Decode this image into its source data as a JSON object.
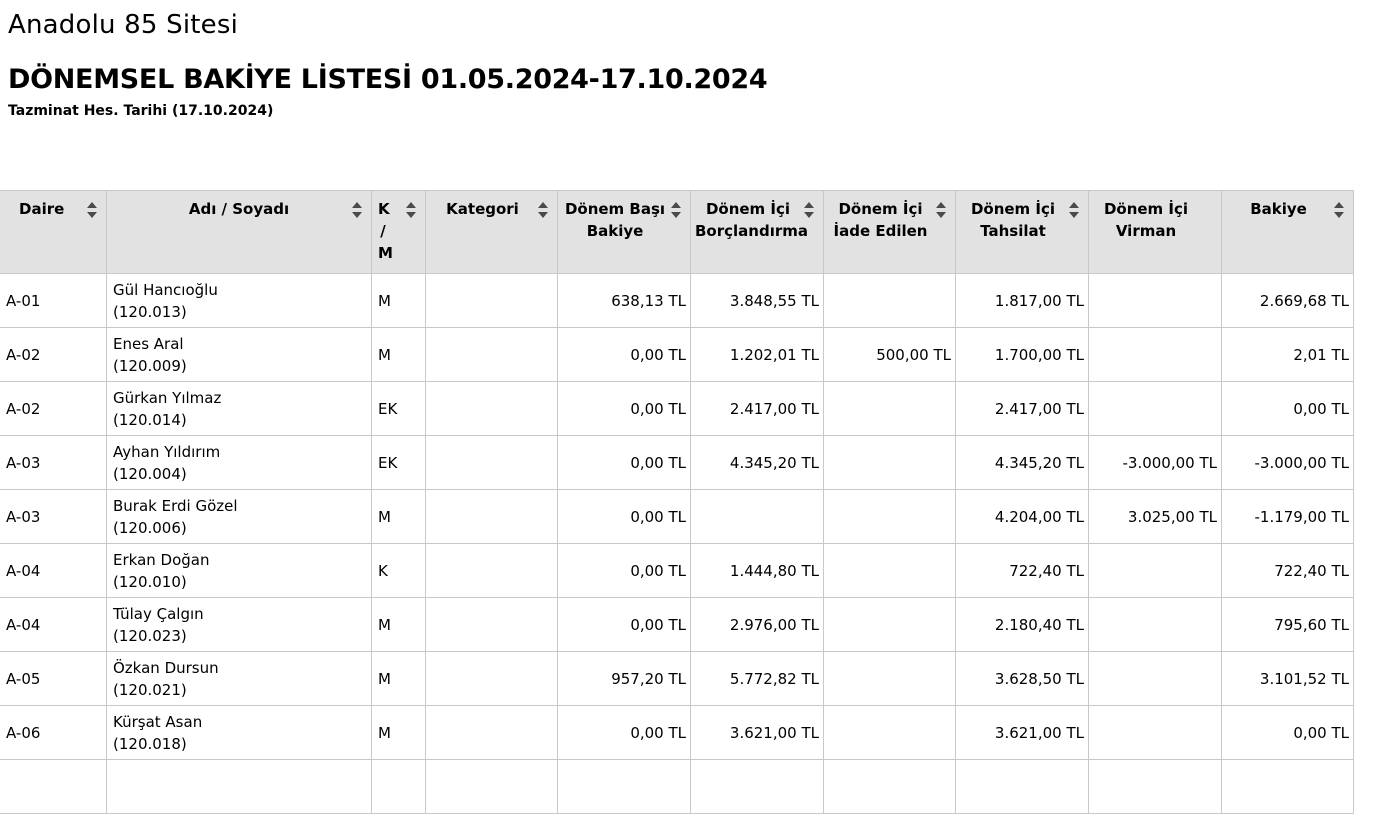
{
  "site": {
    "title": "Anadolu 85 Sitesi"
  },
  "report": {
    "title": "DÖNEMSEL BAKİYE LİSTESİ 01.05.2024-17.10.2024",
    "subtitle": "Tazminat Hes. Tarihi (17.10.2024)"
  },
  "table": {
    "headers": [
      {
        "label": "Daire",
        "sortable": true
      },
      {
        "label": "Adı / Soyadı",
        "sortable": true
      },
      {
        "label": "K / M",
        "sortable": true
      },
      {
        "label": "Kategori",
        "sortable": true
      },
      {
        "label": "Dönem Başı Bakiye",
        "sortable": true
      },
      {
        "label": "Dönem İçi Borçlandırma",
        "sortable": true
      },
      {
        "label": "Dönem İçi İade Edilen",
        "sortable": true
      },
      {
        "label": "Dönem İçi Tahsilat",
        "sortable": true
      },
      {
        "label": "Dönem İçi Virman",
        "sortable": false
      },
      {
        "label": "Bakiye",
        "sortable": true
      }
    ],
    "rows": [
      {
        "daire": "A-01",
        "name": "Gül Hancıoğlu",
        "code": "(120.013)",
        "km": "M",
        "kategori": "",
        "donem_basi": "638,13 TL",
        "borc": "3.848,55 TL",
        "iade": "",
        "tahsilat": "1.817,00 TL",
        "virman": "",
        "bakiye": "2.669,68 TL"
      },
      {
        "daire": "A-02",
        "name": "Enes Aral",
        "code": "(120.009)",
        "km": "M",
        "kategori": "",
        "donem_basi": "0,00 TL",
        "borc": "1.202,01 TL",
        "iade": "500,00 TL",
        "tahsilat": "1.700,00 TL",
        "virman": "",
        "bakiye": "2,01 TL"
      },
      {
        "daire": "A-02",
        "name": "Gürkan Yılmaz",
        "code": "(120.014)",
        "km": "EK",
        "kategori": "",
        "donem_basi": "0,00 TL",
        "borc": "2.417,00 TL",
        "iade": "",
        "tahsilat": "2.417,00 TL",
        "virman": "",
        "bakiye": "0,00 TL"
      },
      {
        "daire": "A-03",
        "name": "Ayhan Yıldırım",
        "code": "(120.004)",
        "km": "EK",
        "kategori": "",
        "donem_basi": "0,00 TL",
        "borc": "4.345,20 TL",
        "iade": "",
        "tahsilat": "4.345,20 TL",
        "virman": "-3.000,00 TL",
        "bakiye": "-3.000,00 TL"
      },
      {
        "daire": "A-03",
        "name": "Burak Erdi Gözel",
        "code": "(120.006)",
        "km": "M",
        "kategori": "",
        "donem_basi": "0,00 TL",
        "borc": "",
        "iade": "",
        "tahsilat": "4.204,00 TL",
        "virman": "3.025,00 TL",
        "bakiye": "-1.179,00 TL"
      },
      {
        "daire": "A-04",
        "name": "Erkan Doğan",
        "code": "(120.010)",
        "km": "K",
        "kategori": "",
        "donem_basi": "0,00 TL",
        "borc": "1.444,80 TL",
        "iade": "",
        "tahsilat": "722,40 TL",
        "virman": "",
        "bakiye": "722,40 TL"
      },
      {
        "daire": "A-04",
        "name": "Tülay Çalgın",
        "code": "(120.023)",
        "km": "M",
        "kategori": "",
        "donem_basi": "0,00 TL",
        "borc": "2.976,00 TL",
        "iade": "",
        "tahsilat": "2.180,40 TL",
        "virman": "",
        "bakiye": "795,60 TL"
      },
      {
        "daire": "A-05",
        "name": "Özkan Dursun",
        "code": "(120.021)",
        "km": "M",
        "kategori": "",
        "donem_basi": "957,20 TL",
        "borc": "5.772,82 TL",
        "iade": "",
        "tahsilat": "3.628,50 TL",
        "virman": "",
        "bakiye": "3.101,52 TL"
      },
      {
        "daire": "A-06",
        "name": "Kürşat Asan",
        "code": "(120.018)",
        "km": "M",
        "kategori": "",
        "donem_basi": "0,00 TL",
        "borc": "3.621,00 TL",
        "iade": "",
        "tahsilat": "3.621,00 TL",
        "virman": "",
        "bakiye": "0,00 TL"
      },
      {
        "daire": "",
        "name": "",
        "code": "",
        "km": "",
        "kategori": "",
        "donem_basi": "",
        "borc": "",
        "iade": "",
        "tahsilat": "",
        "virman": "",
        "bakiye": ""
      }
    ]
  },
  "icons": {
    "sort": "sort-updown-icon"
  }
}
